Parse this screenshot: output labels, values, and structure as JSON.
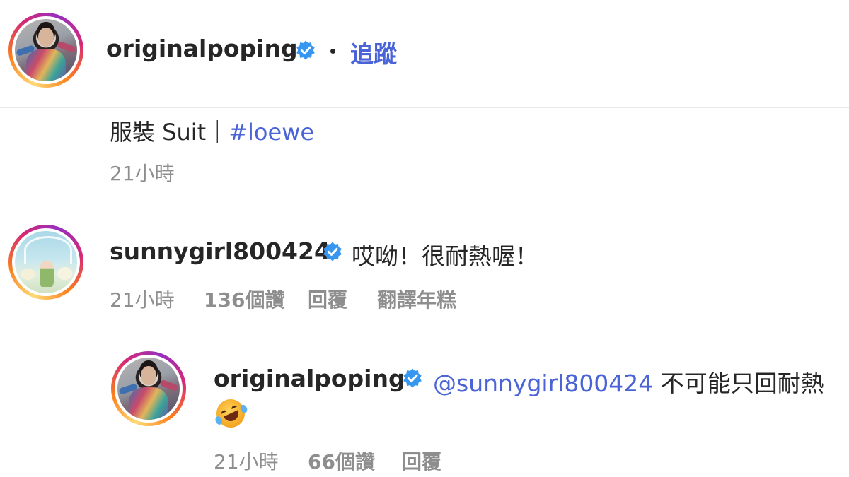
{
  "post": {
    "author": "originalpoping",
    "follow_label": "追蹤",
    "caption_prefix": "服裝 Suit｜",
    "caption_hashtag": "#loewe",
    "timestamp": "21小時"
  },
  "comments": [
    {
      "username": "sunnygirl800424",
      "text": "哎呦！很耐熱喔！",
      "timestamp": "21小時",
      "likes": "136個讚",
      "reply_label": "回覆",
      "translate_label": "翻譯年糕"
    }
  ],
  "reply": {
    "username": "originalpoping",
    "mention": "@sunnygirl800424",
    "text": "不可能只回耐熱",
    "emoji": "rolling-on-the-floor-laughing",
    "timestamp": "21小時",
    "likes": "66個讚",
    "reply_label": "回覆"
  },
  "colors": {
    "link": "#4a63d6",
    "verified": "#3797f0",
    "muted": "#8e8e8e",
    "text": "#262626"
  }
}
